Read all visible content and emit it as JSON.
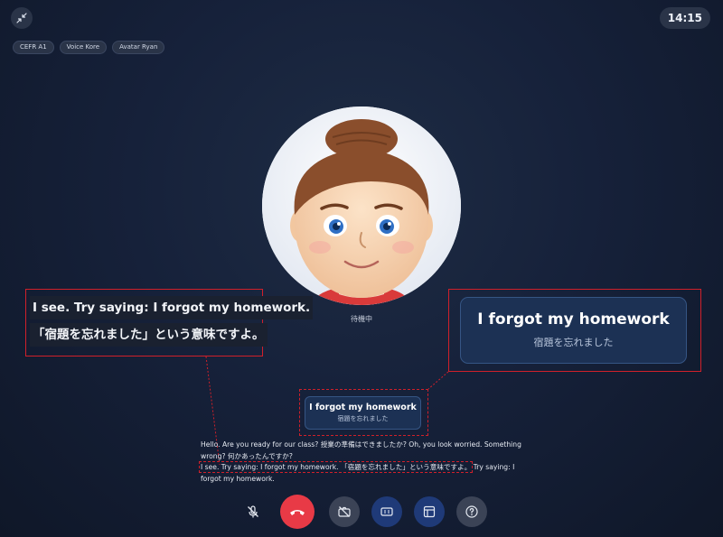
{
  "header": {
    "clock": "14:15",
    "tags": [
      "CEFR A1",
      "Voice Kore",
      "Avatar Ryan"
    ]
  },
  "avatar": {
    "status": "待機中"
  },
  "subtitle_zoom": {
    "line1": "I see. Try saying: I forgot my homework.",
    "line2": "「宿題を忘れました」という意味ですよ。"
  },
  "suggestion": {
    "english": "I forgot my homework",
    "japanese": "宿題を忘れました"
  },
  "transcript": {
    "line1": "Hello. Are you ready for our class? 授業の準備はできましたか? Oh, you look worried. Something wrong? 何かあったんですか?",
    "highlight": "I see. Try saying: I forgot my homework. 「宿題を忘れました」という意味ですよ。",
    "after": " Try saying: I forgot my homework."
  },
  "colors": {
    "background": "#16213a",
    "hangup": "#e83a46",
    "callout_border": "#d0202a",
    "card": "#1c3154"
  },
  "icons": {
    "exit_fullscreen": "collapse-arrows-icon",
    "mic": "mic-off-icon",
    "hangup": "phone-hangup-icon",
    "camera": "camera-off-icon",
    "captions": "captions-icon",
    "layout": "layout-icon",
    "help": "help-icon"
  }
}
